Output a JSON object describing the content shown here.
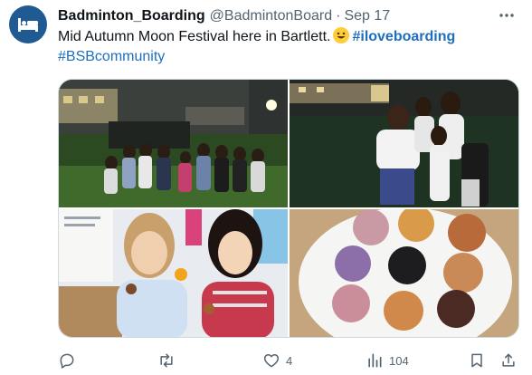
{
  "tweet": {
    "display_name": "Badminton_Boarding",
    "handle": "@BadmintonBoard",
    "separator": "·",
    "date": "Sep 17",
    "text_main": "Mid Autumn Moon Festival here in Bartlett.",
    "hashtag_1": "#iloveboarding",
    "hashtag_2": "#BSBcommunity",
    "emoji_icon": "grinning-face-emoji"
  },
  "media": {
    "photos": [
      {
        "description_icon": "group-night-photo"
      },
      {
        "description_icon": "friends-night-photo"
      },
      {
        "description_icon": "students-mooncake-photo"
      },
      {
        "description_icon": "mooncakes-plate-photo"
      }
    ]
  },
  "actions": {
    "reply_count": "",
    "retweet_count": "",
    "like_count": "4",
    "views_count": "104"
  },
  "colors": {
    "accent_link": "#1d6fbe",
    "avatar_bg": "#1f5a93",
    "muted": "#536471"
  }
}
